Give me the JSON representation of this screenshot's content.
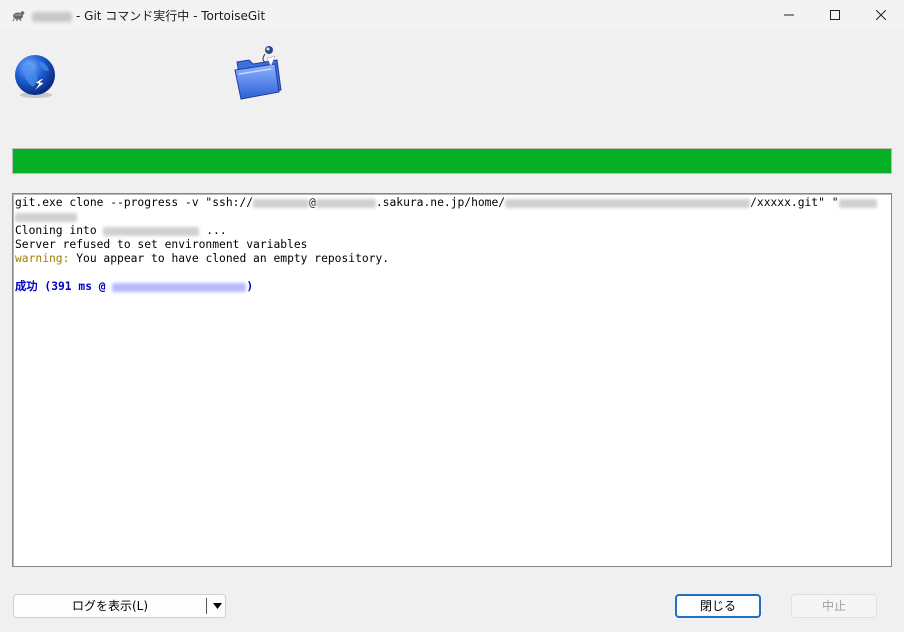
{
  "window": {
    "title": "- Git コマンド実行中 - TortoiseGit",
    "icons": {
      "app": "tortoisegit-turtle-icon",
      "minimize": "minimize-icon",
      "maximize": "maximize-icon",
      "close": "close-icon"
    }
  },
  "header_icons": {
    "left": "globe-remote-icon",
    "right": "folder-clone-icon"
  },
  "progress": {
    "value_percent": 100,
    "color": "#06b025"
  },
  "log": {
    "line1": {
      "a": "git.exe clone --progress -v \"ssh://",
      "b": "@",
      "c": ".sakura.ne.jp/home/",
      "d": "/xxxxx.git\" \""
    },
    "line3": {
      "a": "Cloning into",
      "b": "..."
    },
    "line4": "Server refused to set environment variables",
    "line5": {
      "warn": "warning:",
      "rest": " You appear to have cloned an empty repository."
    },
    "line7": {
      "a": "成功 (391 ms @",
      "b": ")"
    },
    "colors": {
      "warning": "#a08000",
      "success": "#0000c8"
    }
  },
  "buttons": {
    "show_log": "ログを表示(L)",
    "close": "閉じる",
    "abort": "中止"
  }
}
